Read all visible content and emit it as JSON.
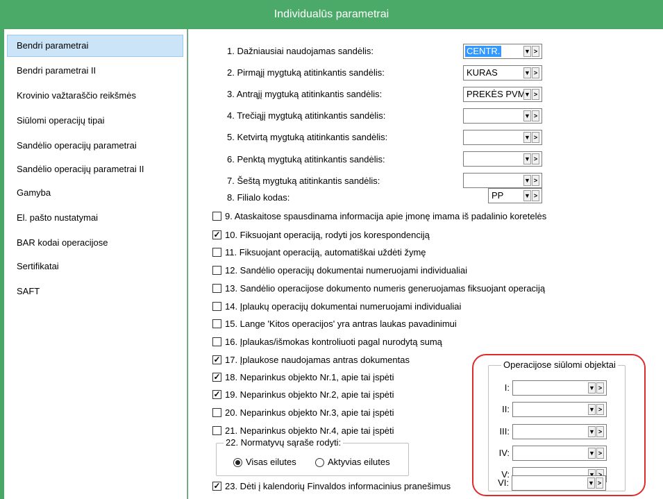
{
  "window": {
    "title": "Individualūs parametrai"
  },
  "sidebar": {
    "items": [
      {
        "label": "Bendri parametrai",
        "active": true
      },
      {
        "label": "Bendri parametrai II"
      },
      {
        "label": "Krovinio važtaraščio reikšmės"
      },
      {
        "label": "Siūlomi operacijų tipai"
      },
      {
        "label": "Sandėlio operacijų parametrai"
      },
      {
        "label": "Sandėlio operacijų parametrai II"
      },
      {
        "label": "Gamyba"
      },
      {
        "label": "El. pašto nustatymai"
      },
      {
        "label": "BAR kodai operacijose"
      },
      {
        "label": "Sertifikatai"
      },
      {
        "label": "SAFT"
      }
    ]
  },
  "warehouse_fields": [
    {
      "label": "1. Dažniausiai naudojamas sandėlis:",
      "value": "CENTR."
    },
    {
      "label": "2. Pirmąjį mygtuką atitinkantis sandėlis:",
      "value": "KURAS"
    },
    {
      "label": "3. Antrąjį mygtuką atitinkantis sandėlis:",
      "value": "PREKĖS PVM"
    },
    {
      "label": "4. Trečiąjį mygtuką atitinkantis sandėlis:",
      "value": ""
    },
    {
      "label": "5. Ketvirtą mygtuką atitinkantis sandėlis:",
      "value": ""
    },
    {
      "label": "6. Penktą mygtuką atitinkantis sandėlis:",
      "value": ""
    },
    {
      "label": "7. Šeštą mygtuką atitinkantis sandėlis:",
      "value": ""
    }
  ],
  "branch": {
    "label": "8. Filialo kodas:",
    "value": "PP"
  },
  "combo_buttons": {
    "dropdown": "▼",
    "browse": ">"
  },
  "checkboxes": [
    {
      "label": "9. Ataskaitose spausdinama informacija apie įmonę imama iš padalinio koretelės",
      "checked": false
    },
    {
      "label": "10. Fiksuojant operaciją, rodyti jos korespondenciją",
      "checked": true
    },
    {
      "label": "11. Fiksuojant operaciją, automatiškai uždėti žymę",
      "checked": false
    },
    {
      "label": "12. Sandėlio operacijų dokumentai numeruojami individualiai",
      "checked": false
    },
    {
      "label": "13. Sandėlio operacijose dokumento numeris generuojamas fiksuojant operaciją",
      "checked": false
    },
    {
      "label": "14. Įplaukų operacijų dokumentai numeruojami individualiai",
      "checked": false
    },
    {
      "label": "15. Lange 'Kitos operacijos' yra antras laukas pavadinimui",
      "checked": false
    },
    {
      "label": "16. Įplaukas/išmokas kontroliuoti pagal nurodytą sumą",
      "checked": false
    },
    {
      "label": "17. Įplaukose naudojamas antras dokumentas",
      "checked": true
    },
    {
      "label": "18. Neparinkus objekto Nr.1, apie tai įspėti",
      "checked": true
    },
    {
      "label": "19. Neparinkus objekto Nr.2, apie tai įspėti",
      "checked": true
    },
    {
      "label": "20. Neparinkus objekto Nr.3, apie tai įspėti",
      "checked": false
    },
    {
      "label": "21. Neparinkus objekto Nr.4, apie tai įspėti",
      "checked": false
    }
  ],
  "normative_group": {
    "title": "22. Normatyvų sąraše rodyti:",
    "options": [
      {
        "label": "Visas eilutes",
        "selected": true
      },
      {
        "label": "Aktyvias eilutes",
        "selected": false
      }
    ]
  },
  "checkbox23": {
    "label": "23. Dėti į kalendorių Finvaldos informacinius pranešimus",
    "checked": true
  },
  "objects_group": {
    "title": "Operacijose siūlomi objektai",
    "rows": [
      {
        "label": "I:",
        "value": ""
      },
      {
        "label": "II:",
        "value": ""
      },
      {
        "label": "III:",
        "value": ""
      },
      {
        "label": "IV:",
        "value": ""
      },
      {
        "label": "V:",
        "value": ""
      },
      {
        "label": "VI:",
        "value": ""
      }
    ]
  },
  "colors": {
    "titlebar": "#4caa68",
    "selection": "#3399ff",
    "highlight_frame": "#e02a2a",
    "sidebar_active": "#cce4f7"
  }
}
